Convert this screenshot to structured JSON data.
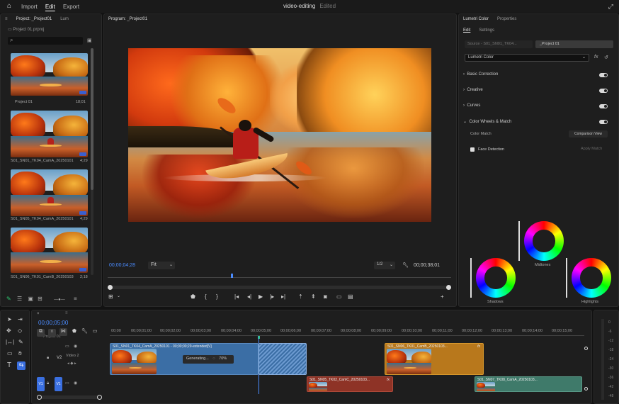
{
  "topbar": {
    "menu": [
      "Import",
      "Edit",
      "Export"
    ],
    "title": "video-editing",
    "status": "Edited"
  },
  "project_panel": {
    "tabs": [
      "Project: _Project01",
      "Lum"
    ],
    "file_name": "Project 01.prproj",
    "clips": [
      {
        "name": "Project 01",
        "duration": "18;01"
      },
      {
        "name": "S01_SN01_TK04_CamA_20250101",
        "duration": "4;29"
      },
      {
        "name": "S01_SN05_TK04_CamA_20250101",
        "duration": "4;29"
      },
      {
        "name": "S01_SN06_TK01_CamB_20250103",
        "duration": "2;18"
      }
    ]
  },
  "program_monitor": {
    "tab": "Program: _Project01",
    "timecode_left": "00;00;04;28",
    "fit": "Fit",
    "quality": "1/2",
    "timecode_right": "00;00;38;01"
  },
  "lumetri": {
    "tabs": [
      "Lumetri Color",
      "Properties"
    ],
    "subtabs": [
      "Edit",
      "Settings"
    ],
    "source": "Source - S01_SN01_TK04...",
    "target": "_Project 01",
    "preset": "Lumetri Color",
    "sections": [
      "Basic Correction",
      "Creative",
      "Curves",
      "Color Wheels & Match"
    ],
    "color_match_label": "Color Match",
    "comparison_view": "Comparison View",
    "face_detection": "Face Detection",
    "apply_match": "Apply Match",
    "wheels": [
      "Midtones",
      "Shadows",
      "Highlights"
    ]
  },
  "timeline": {
    "timecode": "00;00;05;00",
    "sequence": "Project 01",
    "ruler": [
      "00;00",
      "00;00;01;00",
      "00;00;02;00",
      "00;00;03;00",
      "00;00;04;00",
      "00;00;05;00",
      "00;00;06;00",
      "00;00;07;00",
      "00;00;08;00",
      "00;00;09;00",
      "00;00;10;00",
      "00;00;11;00",
      "00;00;12;00",
      "00;00;13;00",
      "00;00;14;00",
      "00;00;15;00"
    ],
    "tracks": [
      "V2",
      "V1"
    ],
    "track_name": "Video 2",
    "clips": [
      {
        "label": "S01_SN01_TK04_CamA_20250101 - 00;00;00;29-extended[V]",
        "color": "#3b6ea5"
      },
      {
        "label": "S01_SN06_TK01_CamB_20250103...",
        "color": "#b8781c"
      },
      {
        "label": "S01_SN05_TK02_CamC_20250103...",
        "color": "#8e3326"
      },
      {
        "label": "S01_SN07_TK08_CamA_20250103...",
        "color": "#3f7a6a"
      }
    ],
    "generating": "Generating...",
    "progress": "70%"
  },
  "meter_ticks": [
    "0",
    "-6",
    "-12",
    "-18",
    "-24",
    "-30",
    "-36",
    "-42",
    "-48"
  ]
}
